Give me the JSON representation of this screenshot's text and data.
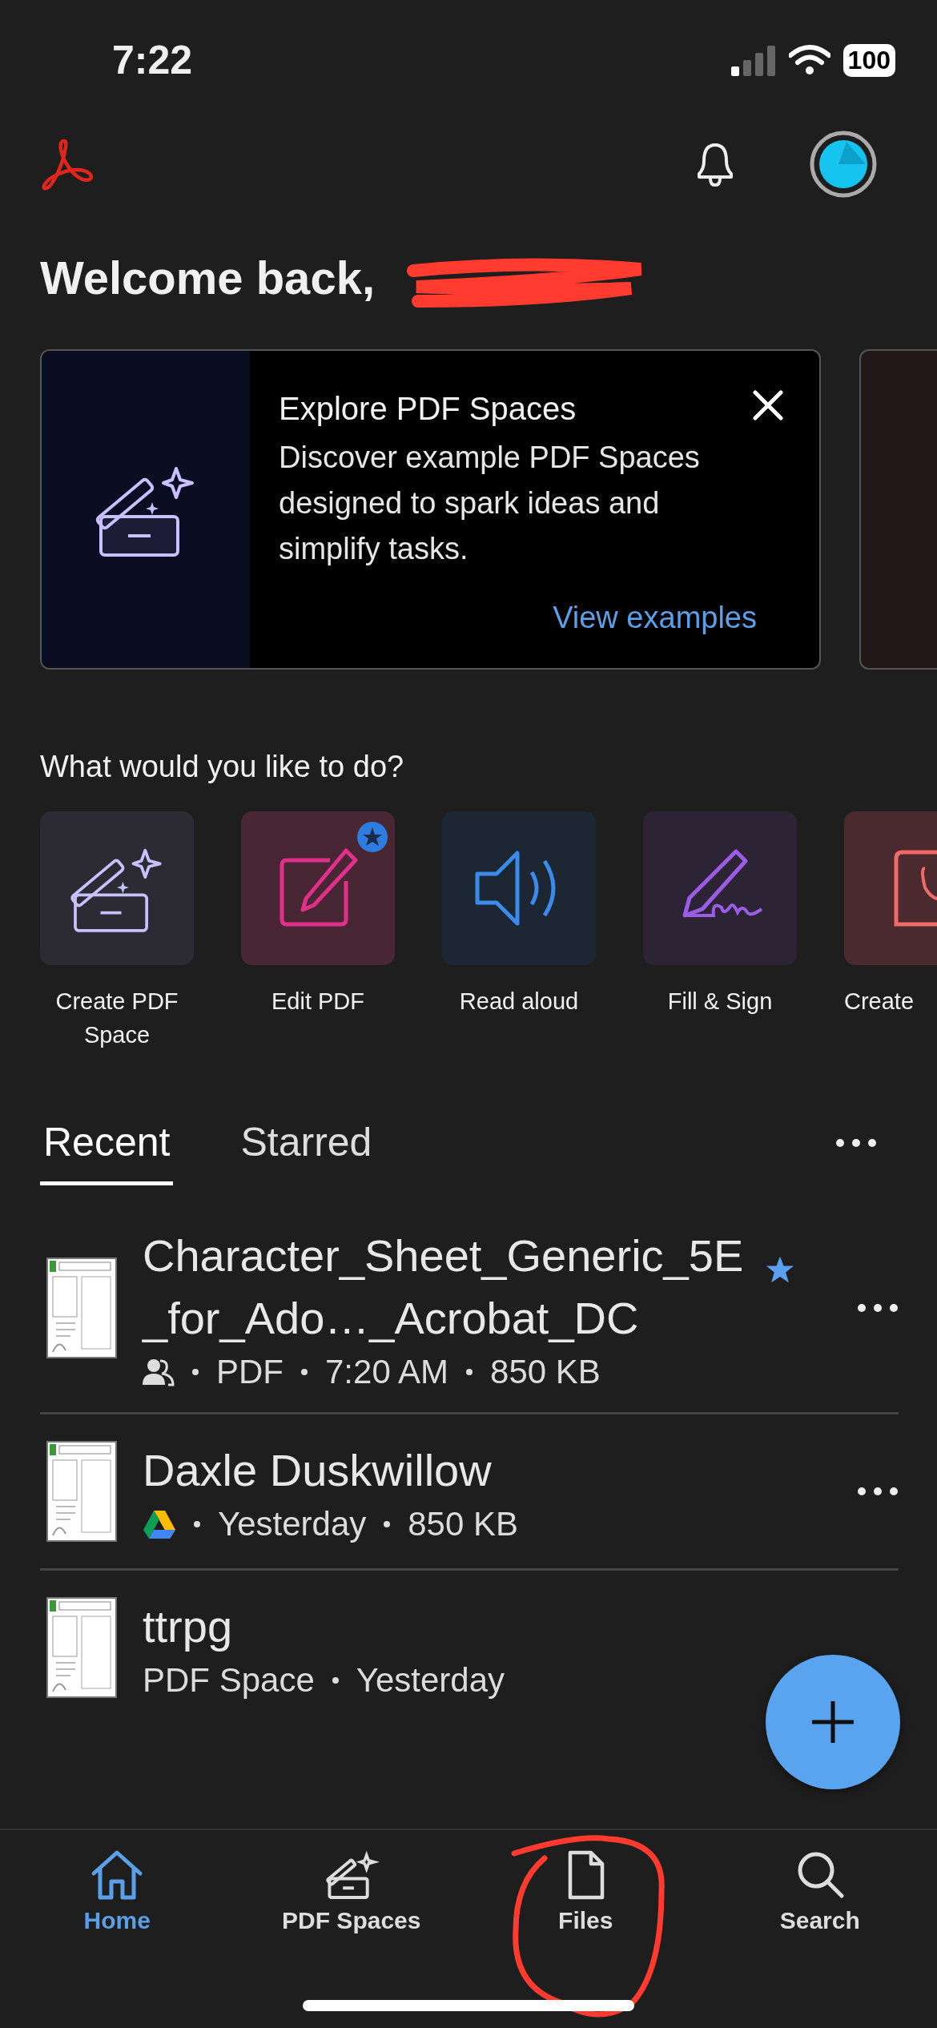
{
  "status_bar": {
    "time": "7:22",
    "battery": "100"
  },
  "greeting": "Welcome back,",
  "banner": {
    "title": "Explore PDF Spaces",
    "body": "Discover example PDF Spaces designed to spark ideas and simplify tasks.",
    "link": "View examples"
  },
  "section_title": "What would you like to do?",
  "actions": [
    {
      "kind": "space",
      "label": "Create PDF Space",
      "badge": false
    },
    {
      "kind": "edit",
      "label": "Edit PDF",
      "badge": true
    },
    {
      "kind": "read",
      "label": "Read aloud",
      "badge": false
    },
    {
      "kind": "sign",
      "label": "Fill & Sign",
      "badge": false
    },
    {
      "kind": "create",
      "label": "Create"
    }
  ],
  "tabs": [
    {
      "label": "Recent",
      "selected": true
    },
    {
      "label": "Starred",
      "selected": false
    }
  ],
  "files": [
    {
      "name": "Character_Sheet_Generic_5E_for_Ado…_Acrobat_DC",
      "starred": true,
      "kind": "shared",
      "meta": [
        "PDF",
        "7:20 AM",
        "850 KB"
      ]
    },
    {
      "name": "Daxle Duskwillow",
      "starred": false,
      "kind": "drive",
      "meta": [
        "Yesterday",
        "850 KB"
      ]
    },
    {
      "name": "ttrpg",
      "starred": false,
      "kind": "space",
      "meta": [
        "PDF Space",
        "Yesterday"
      ]
    }
  ],
  "nav": [
    {
      "kind": "home",
      "label": "Home",
      "selected": true
    },
    {
      "kind": "spaces",
      "label": "PDF Spaces",
      "selected": false
    },
    {
      "kind": "files",
      "label": "Files",
      "selected": false
    },
    {
      "kind": "search",
      "label": "Search",
      "selected": false
    }
  ]
}
